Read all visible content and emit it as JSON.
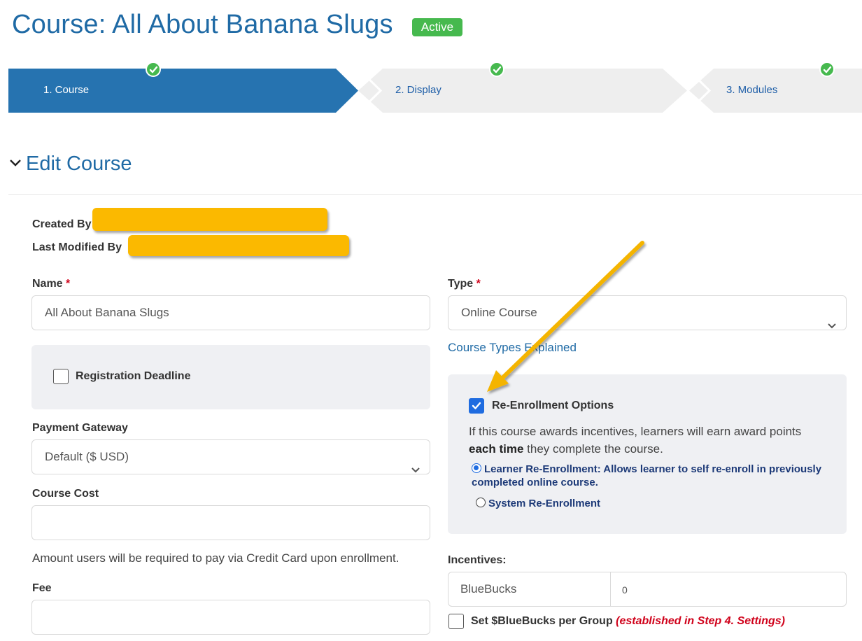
{
  "header": {
    "title": "Course: All About Banana Slugs",
    "status_badge": "Active",
    "status_color": "#46b94e"
  },
  "stepper": {
    "steps": [
      {
        "label": "1. Course",
        "active": true,
        "complete": true
      },
      {
        "label": "2. Display",
        "active": false,
        "complete": true
      },
      {
        "label": "3. Modules",
        "active": false,
        "complete": true
      }
    ],
    "active_color": "#2673b0",
    "inactive_color": "#eeeeee"
  },
  "section": {
    "title": "Edit Course",
    "chevron_icon": "chevron-down-icon"
  },
  "meta": {
    "created_by_label": "Created By",
    "last_modified_label": "Last Modified By"
  },
  "form": {
    "name_label": "Name",
    "name_value": "All About Banana Slugs",
    "type_label": "Type",
    "type_value": "Online Course",
    "type_link": "Course Types Explained",
    "required_marker": "*",
    "registration_deadline_label": "Registration Deadline",
    "registration_deadline_checked": false,
    "payment_gateway_label": "Payment Gateway",
    "payment_gateway_value": "Default ($ USD)",
    "course_cost_label": "Course Cost",
    "course_cost_value": "",
    "course_cost_help": "Amount users will be required to pay via Credit Card upon enrollment.",
    "fee_label": "Fee",
    "fee_value": ""
  },
  "reenrollment": {
    "label": "Re-Enrollment Options",
    "checked": true,
    "help_prefix": "If this course awards incentives, learners will earn award points",
    "help_bold": "each time",
    "help_suffix": "they complete the course.",
    "options": [
      {
        "label": "Learner Re-Enrollment: Allows learner to self re-enroll in previously completed online course.",
        "selected": true
      },
      {
        "label": "System Re-Enrollment",
        "selected": false
      }
    ]
  },
  "incentives": {
    "label": "Incentives:",
    "currency_name": "BlueBucks",
    "amount": "0",
    "per_group_label": "Set $BlueBucks per Group",
    "per_group_note": "(established in Step 4. Settings)",
    "per_group_checked": false
  },
  "annotation": {
    "arrow_color": "#f4b400",
    "redaction_color": "#fbb900"
  }
}
